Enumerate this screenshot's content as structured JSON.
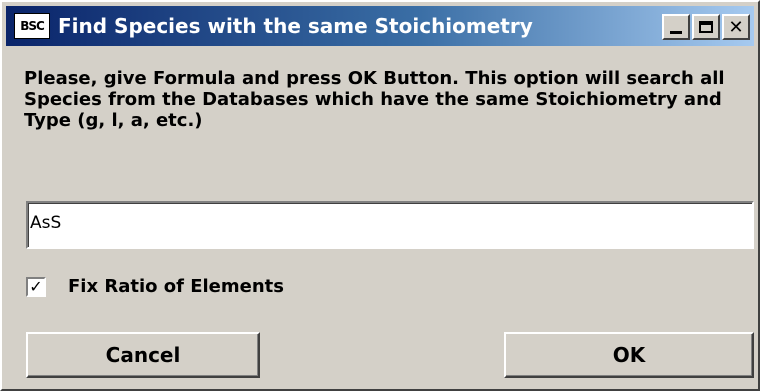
{
  "window": {
    "title": "Find Species with the same Stoichiometry",
    "app_icon_text": "BSC",
    "controls": [
      "minimize",
      "maximize",
      "close"
    ]
  },
  "description": "Please, give Formula and press OK Button. This option will search all Species from the Databases which have the same Stoichiometry and Type (g, l, a, etc.)",
  "formula_input": {
    "value": "AsS"
  },
  "fix_ratio": {
    "label": "Fix Ratio of Elements",
    "checked": true,
    "check_glyph": "✓"
  },
  "buttons": {
    "cancel": "Cancel",
    "ok": "OK"
  },
  "colors": {
    "face": "#d4d0c8",
    "title_start": "#0a246a",
    "title_end": "#a6caf0",
    "title_text": "#ffffff"
  }
}
